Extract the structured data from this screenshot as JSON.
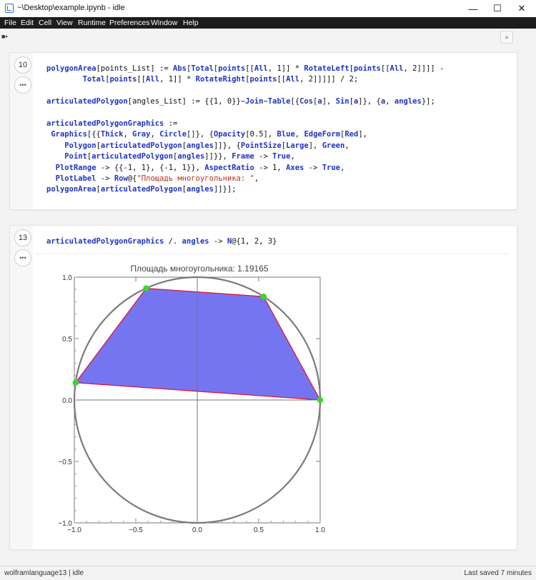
{
  "window": {
    "title": "~\\Desktop\\example.ipynb - idle",
    "controls": {
      "minimize": "—",
      "maximize": "☐",
      "close": "✕"
    }
  },
  "menu": [
    "File",
    "Edit",
    "Cell",
    "View",
    "Runtime",
    "Preferences",
    "Window",
    "Help"
  ],
  "toolbar": {
    "sidebar_toggle": "■▪",
    "collapse_icon": "≡"
  },
  "cells": [
    {
      "execution_count": "10",
      "menu_label": "•••",
      "code_lines": [
        [
          {
            "t": "polygonArea",
            "k": 1
          },
          {
            "t": "[points_List] := "
          },
          {
            "t": "Abs",
            "k": 1
          },
          {
            "t": "["
          },
          {
            "t": "Total",
            "k": 1
          },
          {
            "t": "["
          },
          {
            "t": "points",
            "k": 1
          },
          {
            "t": "[["
          },
          {
            "t": "All",
            "k": 1
          },
          {
            "t": ", 1]] * "
          },
          {
            "t": "RotateLeft",
            "k": 1
          },
          {
            "t": "["
          },
          {
            "t": "points",
            "k": 1
          },
          {
            "t": "[["
          },
          {
            "t": "All",
            "k": 1
          },
          {
            "t": ", 2]]]] -"
          }
        ],
        [
          {
            "t": "        "
          },
          {
            "t": "Total",
            "k": 1
          },
          {
            "t": "["
          },
          {
            "t": "points",
            "k": 1
          },
          {
            "t": "[["
          },
          {
            "t": "All",
            "k": 1
          },
          {
            "t": ", 1]] * "
          },
          {
            "t": "RotateRight",
            "k": 1
          },
          {
            "t": "["
          },
          {
            "t": "points",
            "k": 1
          },
          {
            "t": "[["
          },
          {
            "t": "All",
            "k": 1
          },
          {
            "t": ", 2]]]]] / 2;"
          }
        ],
        [
          {
            "t": ""
          }
        ],
        [
          {
            "t": "articulatedPolygon",
            "k": 1
          },
          {
            "t": "[angles_List] := {{1, 0}}~"
          },
          {
            "t": "Join",
            "k": 1
          },
          {
            "t": "~"
          },
          {
            "t": "Table",
            "k": 1
          },
          {
            "t": "[{"
          },
          {
            "t": "Cos",
            "k": 1
          },
          {
            "t": "["
          },
          {
            "t": "a",
            "k": 1
          },
          {
            "t": "], "
          },
          {
            "t": "Sin",
            "k": 1
          },
          {
            "t": "["
          },
          {
            "t": "a",
            "k": 1
          },
          {
            "t": "]}, {"
          },
          {
            "t": "a",
            "k": 1
          },
          {
            "t": ", "
          },
          {
            "t": "angles",
            "k": 1
          },
          {
            "t": "}];"
          }
        ],
        [
          {
            "t": ""
          }
        ],
        [
          {
            "t": "articulatedPolygonGraphics",
            "k": 1
          },
          {
            "t": " :="
          }
        ],
        [
          {
            "t": " "
          },
          {
            "t": "Graphics",
            "k": 1
          },
          {
            "t": "[{{"
          },
          {
            "t": "Thick",
            "k": 1
          },
          {
            "t": ", "
          },
          {
            "t": "Gray",
            "k": 1
          },
          {
            "t": ", "
          },
          {
            "t": "Circle",
            "k": 1
          },
          {
            "t": "[]}, {"
          },
          {
            "t": "Opacity",
            "k": 1
          },
          {
            "t": "[0.5], "
          },
          {
            "t": "Blue",
            "k": 1
          },
          {
            "t": ", "
          },
          {
            "t": "EdgeForm",
            "k": 1
          },
          {
            "t": "["
          },
          {
            "t": "Red",
            "k": 1
          },
          {
            "t": "],"
          }
        ],
        [
          {
            "t": "    "
          },
          {
            "t": "Polygon",
            "k": 1
          },
          {
            "t": "["
          },
          {
            "t": "articulatedPolygon",
            "k": 1
          },
          {
            "t": "["
          },
          {
            "t": "angles",
            "k": 1
          },
          {
            "t": "]]}, {"
          },
          {
            "t": "PointSize",
            "k": 1
          },
          {
            "t": "["
          },
          {
            "t": "Large",
            "k": 1
          },
          {
            "t": "], "
          },
          {
            "t": "Green",
            "k": 1
          },
          {
            "t": ","
          }
        ],
        [
          {
            "t": "    "
          },
          {
            "t": "Point",
            "k": 1
          },
          {
            "t": "["
          },
          {
            "t": "articulatedPolygon",
            "k": 1
          },
          {
            "t": "["
          },
          {
            "t": "angles",
            "k": 1
          },
          {
            "t": "]]}}, "
          },
          {
            "t": "Frame",
            "k": 1
          },
          {
            "t": " -> "
          },
          {
            "t": "True",
            "k": 1
          },
          {
            "t": ","
          }
        ],
        [
          {
            "t": "  "
          },
          {
            "t": "PlotRange",
            "k": 1
          },
          {
            "t": " -> {{-1, 1}, {-1, 1}}, "
          },
          {
            "t": "AspectRatio",
            "k": 1
          },
          {
            "t": " -> 1, "
          },
          {
            "t": "Axes",
            "k": 1
          },
          {
            "t": " -> "
          },
          {
            "t": "True",
            "k": 1
          },
          {
            "t": ","
          }
        ],
        [
          {
            "t": "  "
          },
          {
            "t": "PlotLabel",
            "k": 1
          },
          {
            "t": " -> "
          },
          {
            "t": "Row",
            "k": 1
          },
          {
            "t": "@{"
          },
          {
            "t": "\"Площадь многоугольника: \"",
            "s": 1
          },
          {
            "t": ","
          }
        ],
        [
          {
            "t": "polygonArea",
            "k": 1
          },
          {
            "t": "["
          },
          {
            "t": "articulatedPolygon",
            "k": 1
          },
          {
            "t": "["
          },
          {
            "t": "angles",
            "k": 1
          },
          {
            "t": "]]}];"
          }
        ]
      ]
    },
    {
      "execution_count": "13",
      "menu_label": "•••",
      "code_lines": [
        [
          {
            "t": "articulatedPolygonGraphics",
            "k": 1
          },
          {
            "t": " /. "
          },
          {
            "t": "angles",
            "k": 1
          },
          {
            "t": " -> "
          },
          {
            "t": "N",
            "k": 1
          },
          {
            "t": "@{1, 2, 3}"
          }
        ]
      ]
    }
  ],
  "chart_data": {
    "type": "scatter",
    "title": "Площадь многоугольника: 1.19165",
    "xlim": [
      -1,
      1
    ],
    "ylim": [
      -1,
      1
    ],
    "xticks": [
      "−1.0",
      "−0.5",
      "0.0",
      "0.5",
      "1.0"
    ],
    "yticks": [
      "−1.0",
      "−0.5",
      "0.0",
      "0.5",
      "1.0"
    ],
    "tick_values": [
      -1,
      -0.5,
      0,
      0.5,
      1
    ],
    "axes": true,
    "frame": true,
    "circle": {
      "center": [
        0,
        0
      ],
      "radius": 1,
      "color": "#7a7a7a"
    },
    "polygon": {
      "points": [
        [
          1,
          0
        ],
        [
          0.5403,
          0.8415
        ],
        [
          -0.4161,
          0.9093
        ],
        [
          -0.99,
          0.1411
        ]
      ],
      "fill": "#7575f2",
      "edge": "#e0102a"
    },
    "point_color": "#33dd22"
  },
  "status": {
    "left": "wolframlanguage13 | idle",
    "right": "Last saved 7 minutes"
  }
}
